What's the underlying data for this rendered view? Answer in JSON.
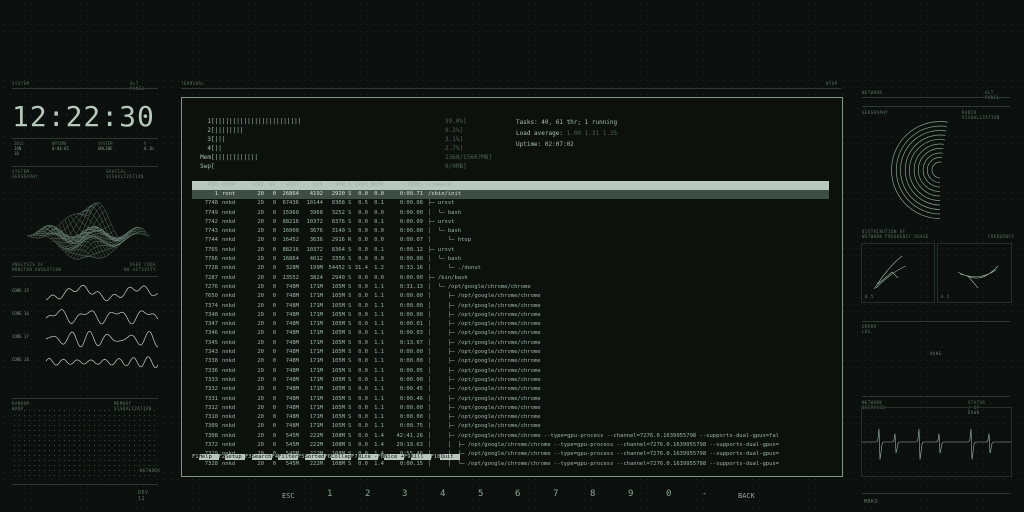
{
  "left_panel": {
    "header_left": "SYSTEM",
    "header_right": "ALT PANEL",
    "clock": "12:22:30",
    "stats": [
      {
        "label": "2015",
        "value": "JAN 10"
      },
      {
        "label": "UPTIME",
        "value": "0:04:05"
      },
      {
        "label": "SYSTEM",
        "value": "ONLINE"
      },
      {
        "label": "V",
        "value": "0.1b"
      }
    ],
    "viz_header_left": "SYSTEM GEOGRAPHY",
    "viz_header_right": "SPATIAL VISUALIZATION",
    "viz_footer_left": "ANALYSIS OF\nMONITOR EVOLUTION",
    "viz_footer_right": "USER CODE\nNO ACTIVITY",
    "cores": [
      {
        "label": "CORE 15",
        "seed": 1
      },
      {
        "label": "CORE 16",
        "seed": 2
      },
      {
        "label": "CORE 17",
        "seed": 3
      },
      {
        "label": "CORE 18",
        "seed": 4
      }
    ],
    "bottom_header_left": "RANDOM WARP",
    "bottom_header_right": "MEMORY VISUALIZATION",
    "bottom_label": "NETWORK",
    "footer": "DEV 12"
  },
  "terminal": {
    "header_left": "TERMINAL",
    "header_right": "HTOP",
    "meters": [
      {
        "label": "1",
        "bar": "[||||||||||||||||||||||||",
        "pct": "39.0%]"
      },
      {
        "label": "2",
        "bar": "[||||||||",
        "pct": "9.2%]"
      },
      {
        "label": "3",
        "bar": "[|||",
        "pct": "3.1%]"
      },
      {
        "label": "4",
        "bar": "[||",
        "pct": "2.7%]"
      },
      {
        "label": "Mem",
        "bar": "[||||||||||||",
        "pct": "1368/15607MB]"
      },
      {
        "label": "Swp",
        "bar": "[",
        "pct": "0/0MB]"
      }
    ],
    "tasks_line": "Tasks: 40, 61 thr; 1 running",
    "load_label": "Load average:",
    "load_values": "1.00 1.31 1.25",
    "uptime_line": "Uptime: 02:07:02",
    "columns": [
      "PID",
      "USER",
      "PRI",
      "NI",
      "VIRT",
      "RES",
      "SHR",
      "S",
      "CPU%",
      "MEM%",
      "TIME+",
      "Command"
    ],
    "processes": [
      {
        "pid": "1",
        "user": "root",
        "pri": "20",
        "ni": "0",
        "virt": "26864",
        "res": "4192",
        "shr": "2920",
        "s": "S",
        "cpu": "0.0",
        "mem": "0.0",
        "time": "0:00.71",
        "cmd": "/sbin/init",
        "sel": true
      },
      {
        "pid": "7748",
        "user": "nnkd",
        "pri": "20",
        "ni": "0",
        "virt": "67436",
        "res": "10144",
        "shr": "8368",
        "s": "S",
        "cpu": "0.5",
        "mem": "0.1",
        "time": "0:00.08",
        "cmd": "├─ urxvt"
      },
      {
        "pid": "7749",
        "user": "nnkd",
        "pri": "20",
        "ni": "0",
        "virt": "15960",
        "res": "3968",
        "shr": "3252",
        "s": "S",
        "cpu": "0.0",
        "mem": "0.0",
        "time": "0:00.00",
        "cmd": "│  └─ bash"
      },
      {
        "pid": "7742",
        "user": "nnkd",
        "pri": "20",
        "ni": "0",
        "virt": "88216",
        "res": "10372",
        "shr": "8376",
        "s": "S",
        "cpu": "0.0",
        "mem": "0.1",
        "time": "0:00.09",
        "cmd": "├─ urxvt"
      },
      {
        "pid": "7743",
        "user": "nnkd",
        "pri": "20",
        "ni": "0",
        "virt": "16000",
        "res": "3676",
        "shr": "3140",
        "s": "S",
        "cpu": "0.0",
        "mem": "0.0",
        "time": "0:00.00",
        "cmd": "│  └─ bash"
      },
      {
        "pid": "7744",
        "user": "nnkd",
        "pri": "20",
        "ni": "0",
        "virt": "16452",
        "res": "3636",
        "shr": "2916",
        "s": "R",
        "cpu": "0.0",
        "mem": "0.0",
        "time": "0:00.07",
        "cmd": "│     └─ htop"
      },
      {
        "pid": "7765",
        "user": "nnkd",
        "pri": "20",
        "ni": "0",
        "virt": "88216",
        "res": "10372",
        "shr": "8364",
        "s": "S",
        "cpu": "0.0",
        "mem": "0.1",
        "time": "0:00.12",
        "cmd": "├─ urxvt"
      },
      {
        "pid": "7766",
        "user": "nnkd",
        "pri": "20",
        "ni": "0",
        "virt": "16864",
        "res": "4012",
        "shr": "3356",
        "s": "S",
        "cpu": "0.0",
        "mem": "0.0",
        "time": "0:00.00",
        "cmd": "│  └─ bash"
      },
      {
        "pid": "7728",
        "user": "nnkd",
        "pri": "20",
        "ni": "0",
        "virt": "328M",
        "res": "199M",
        "shr": "54452",
        "s": "S",
        "cpu": "31.4",
        "mem": "1.2",
        "time": "0:33.16",
        "cmd": "│     └─ ./donut"
      },
      {
        "pid": "7287",
        "user": "nnkd",
        "pri": "20",
        "ni": "0",
        "virt": "13552",
        "res": "3824",
        "shr": "2940",
        "s": "S",
        "cpu": "0.0",
        "mem": "0.0",
        "time": "0:00.00",
        "cmd": "├─ /bin/bash"
      },
      {
        "pid": "7276",
        "user": "nnkd",
        "pri": "20",
        "ni": "0",
        "virt": "748M",
        "res": "171M",
        "shr": "105M",
        "s": "S",
        "cpu": "0.0",
        "mem": "1.1",
        "time": "0:31.13",
        "cmd": "│  └─ /opt/google/chrome/chrome"
      },
      {
        "pid": "7650",
        "user": "nnkd",
        "pri": "20",
        "ni": "0",
        "virt": "748M",
        "res": "171M",
        "shr": "105M",
        "s": "S",
        "cpu": "0.0",
        "mem": "1.1",
        "time": "0:00.00",
        "cmd": "│     ├─ /opt/google/chrome/chrome"
      },
      {
        "pid": "7374",
        "user": "nnkd",
        "pri": "20",
        "ni": "0",
        "virt": "748M",
        "res": "171M",
        "shr": "105M",
        "s": "S",
        "cpu": "0.0",
        "mem": "1.1",
        "time": "0:00.00",
        "cmd": "│     ├─ /opt/google/chrome/chrome"
      },
      {
        "pid": "7348",
        "user": "nnkd",
        "pri": "20",
        "ni": "0",
        "virt": "748M",
        "res": "171M",
        "shr": "105M",
        "s": "S",
        "cpu": "0.0",
        "mem": "1.1",
        "time": "0:00.00",
        "cmd": "│     ├─ /opt/google/chrome/chrome"
      },
      {
        "pid": "7347",
        "user": "nnkd",
        "pri": "20",
        "ni": "0",
        "virt": "748M",
        "res": "171M",
        "shr": "105M",
        "s": "S",
        "cpu": "0.0",
        "mem": "1.1",
        "time": "0:00.01",
        "cmd": "│     ├─ /opt/google/chrome/chrome"
      },
      {
        "pid": "7346",
        "user": "nnkd",
        "pri": "20",
        "ni": "0",
        "virt": "748M",
        "res": "171M",
        "shr": "105M",
        "s": "S",
        "cpu": "0.0",
        "mem": "1.1",
        "time": "0:00.03",
        "cmd": "│     ├─ /opt/google/chrome/chrome"
      },
      {
        "pid": "7345",
        "user": "nnkd",
        "pri": "20",
        "ni": "0",
        "virt": "748M",
        "res": "171M",
        "shr": "105M",
        "s": "S",
        "cpu": "0.0",
        "mem": "1.1",
        "time": "0:13.07",
        "cmd": "│     ├─ /opt/google/chrome/chrome"
      },
      {
        "pid": "7343",
        "user": "nnkd",
        "pri": "20",
        "ni": "0",
        "virt": "748M",
        "res": "171M",
        "shr": "105M",
        "s": "S",
        "cpu": "0.0",
        "mem": "1.1",
        "time": "0:00.00",
        "cmd": "│     ├─ /opt/google/chrome/chrome"
      },
      {
        "pid": "7338",
        "user": "nnkd",
        "pri": "20",
        "ni": "0",
        "virt": "748M",
        "res": "171M",
        "shr": "105M",
        "s": "S",
        "cpu": "0.0",
        "mem": "1.1",
        "time": "0:00.00",
        "cmd": "│     ├─ /opt/google/chrome/chrome"
      },
      {
        "pid": "7336",
        "user": "nnkd",
        "pri": "20",
        "ni": "0",
        "virt": "748M",
        "res": "171M",
        "shr": "105M",
        "s": "S",
        "cpu": "0.0",
        "mem": "1.1",
        "time": "0:00.05",
        "cmd": "│     ├─ /opt/google/chrome/chrome"
      },
      {
        "pid": "7333",
        "user": "nnkd",
        "pri": "20",
        "ni": "0",
        "virt": "748M",
        "res": "171M",
        "shr": "105M",
        "s": "S",
        "cpu": "0.0",
        "mem": "1.1",
        "time": "0:00.00",
        "cmd": "│     ├─ /opt/google/chrome/chrome"
      },
      {
        "pid": "7332",
        "user": "nnkd",
        "pri": "20",
        "ni": "0",
        "virt": "748M",
        "res": "171M",
        "shr": "105M",
        "s": "S",
        "cpu": "0.0",
        "mem": "1.1",
        "time": "0:00.45",
        "cmd": "│     ├─ /opt/google/chrome/chrome"
      },
      {
        "pid": "7331",
        "user": "nnkd",
        "pri": "20",
        "ni": "0",
        "virt": "748M",
        "res": "171M",
        "shr": "105M",
        "s": "S",
        "cpu": "0.0",
        "mem": "1.1",
        "time": "0:00.46",
        "cmd": "│     ├─ /opt/google/chrome/chrome"
      },
      {
        "pid": "7312",
        "user": "nnkd",
        "pri": "20",
        "ni": "0",
        "virt": "748M",
        "res": "171M",
        "shr": "105M",
        "s": "S",
        "cpu": "0.0",
        "mem": "1.1",
        "time": "0:00.00",
        "cmd": "│     ├─ /opt/google/chrome/chrome"
      },
      {
        "pid": "7310",
        "user": "nnkd",
        "pri": "20",
        "ni": "0",
        "virt": "748M",
        "res": "171M",
        "shr": "105M",
        "s": "S",
        "cpu": "0.0",
        "mem": "1.1",
        "time": "0:00.00",
        "cmd": "│     ├─ /opt/google/chrome/chrome"
      },
      {
        "pid": "7309",
        "user": "nnkd",
        "pri": "20",
        "ni": "0",
        "virt": "748M",
        "res": "171M",
        "shr": "105M",
        "s": "S",
        "cpu": "0.0",
        "mem": "1.1",
        "time": "0:00.75",
        "cmd": "│     ├─ /opt/google/chrome/chrome"
      },
      {
        "pid": "7308",
        "user": "nnkd",
        "pri": "20",
        "ni": "0",
        "virt": "545M",
        "res": "222M",
        "shr": "108M",
        "s": "S",
        "cpu": "0.0",
        "mem": "1.4",
        "time": "42:41.26",
        "cmd": "│     ├─ /opt/google/chrome/chrome --type=gpu-process --channel=7276.0.1639955798 --supports-dual-gpus=fal"
      },
      {
        "pid": "7372",
        "user": "nnkd",
        "pri": "20",
        "ni": "0",
        "virt": "545M",
        "res": "222M",
        "shr": "108M",
        "s": "S",
        "cpu": "0.0",
        "mem": "1.4",
        "time": "29:19.63",
        "cmd": "│     │  ├─ /opt/google/chrome/chrome --type=gpu-process --channel=7276.0.1639955798 --supports-dual-gpus="
      },
      {
        "pid": "7329",
        "user": "nnkd",
        "pri": "20",
        "ni": "0",
        "virt": "545M",
        "res": "222M",
        "shr": "108M",
        "s": "S",
        "cpu": "0.0",
        "mem": "1.4",
        "time": "0:55.46",
        "cmd": "│     │  ├─ /opt/google/chrome/chrome --type=gpu-process --channel=7276.0.1639955798 --supports-dual-gpus="
      },
      {
        "pid": "7328",
        "user": "nnkd",
        "pri": "20",
        "ni": "0",
        "virt": "545M",
        "res": "222M",
        "shr": "108M",
        "s": "S",
        "cpu": "0.0",
        "mem": "1.4",
        "time": "0:00.15",
        "cmd": "│     │  └─ /opt/google/chrome/chrome --type=gpu-process --channel=7276.0.1639955798 --supports-dual-gpus="
      }
    ],
    "fkeys": [
      {
        "key": "F1",
        "label": "Help  "
      },
      {
        "key": "F2",
        "label": "Setup "
      },
      {
        "key": "F3",
        "label": "Search"
      },
      {
        "key": "F4",
        "label": "Filter"
      },
      {
        "key": "F5",
        "label": "Sorted"
      },
      {
        "key": "F6",
        "label": "Collap"
      },
      {
        "key": "F7",
        "label": "Nice -"
      },
      {
        "key": "F8",
        "label": "Nice +"
      },
      {
        "key": "F9",
        "label": "Kill  "
      },
      {
        "key": "F10",
        "label": "Quit  "
      }
    ]
  },
  "keyboard": {
    "keys": [
      "ESC",
      "1",
      "2",
      "3",
      "4",
      "5",
      "6",
      "7",
      "8",
      "9",
      "0",
      "-",
      "BACK"
    ]
  },
  "right_panel": {
    "header_left": "NETWORK",
    "header_right": "ALT PANEL",
    "radar_header_left": "GEOGRAPHY",
    "radar_header_right": "RADIO VISUALIZATION",
    "radar_footer_left": "DISTRIBUTION OF\nNETWORK FREQUENCY USAGE",
    "radar_footer_right": "FREQUENCY",
    "mini_labels": [
      "0.5",
      "0.5"
    ],
    "error_header": "ERROR LOG",
    "error_text": "NONE",
    "graph_header_left": "NETWORK OVERVIEW",
    "graph_header_right": "STATUS / UP DOWN",
    "footer": "MBKO"
  }
}
